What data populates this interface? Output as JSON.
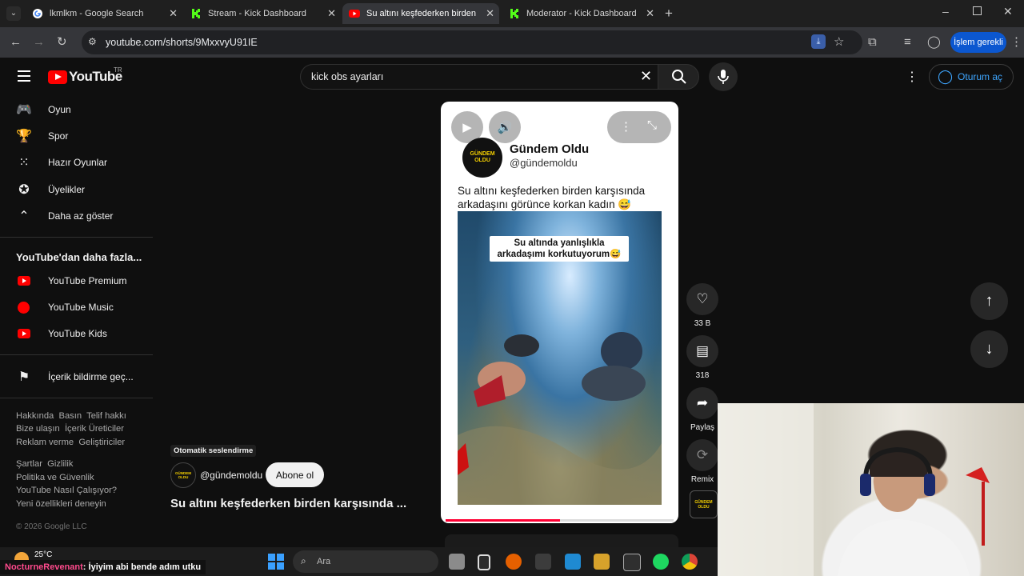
{
  "browser": {
    "tabs": [
      {
        "title": "lkmlkm - Google Search"
      },
      {
        "title": "Stream - Kick Dashboard"
      },
      {
        "title": "Su altını keşfederken birden karşı"
      },
      {
        "title": "Moderator - Kick Dashboard"
      }
    ],
    "url": "youtube.com/shorts/9MxxvyU91IE",
    "action_button": "İşlem gerekli"
  },
  "masthead": {
    "logo_text": "YouTube",
    "region": "TR",
    "search_value": "kick obs ayarları",
    "sign_in": "Oturum aç"
  },
  "sidebar": {
    "items": [
      {
        "label": "Oyun",
        "icon": "game-icon"
      },
      {
        "label": "Spor",
        "icon": "trophy-icon"
      },
      {
        "label": "Hazır Oyunlar",
        "icon": "grid-icon"
      },
      {
        "label": "Üyelikler",
        "icon": "membership-icon"
      },
      {
        "label": "Daha az göster",
        "icon": "chevron-up-icon"
      }
    ],
    "more_heading": "YouTube'dan daha fazla...",
    "more_items": [
      {
        "label": "YouTube Premium"
      },
      {
        "label": "YouTube Music"
      },
      {
        "label": "YouTube Kids"
      }
    ],
    "report": "İçerik bildirme geç...",
    "footer": {
      "row1": [
        "Hakkında",
        "Basın",
        "Telif hakkı"
      ],
      "row2": [
        "Bize ulaşın",
        "İçerik Üreticiler"
      ],
      "row3": [
        "Reklam verme",
        "Geliştiriciler"
      ],
      "row4": [
        "Şartlar",
        "Gizlilik"
      ],
      "row5": "Politika ve Güvenlik",
      "row6": "YouTube Nasıl Çalışıyor?",
      "row7": "Yeni özellikleri deneyin",
      "copyright": "© 2026 Google LLC"
    }
  },
  "short": {
    "account_name": "Gündem Oldu",
    "account_handle": "@gündemoldu",
    "avatar_text": "GÜNDEM OLDU",
    "caption": "Su altını keşfederken birden karşısında arkadaşını görünce korkan kadın 😅",
    "overlay_text": "Su altında yanlışlıkla arkadaşımı korkutuyorum😅",
    "progress": 0.5,
    "badge": "Otomatik seslendirme",
    "channel": "@gündemoldu",
    "subscribe": "Abone ol",
    "title": "Su altını keşfederken birden karşısında ..."
  },
  "actions": {
    "likes": "33 B",
    "comments": "318",
    "share": "Paylaş",
    "remix": "Remix"
  },
  "taskbar": {
    "weather_temp": "25°C",
    "search_placeholder": "Ara",
    "chat_user": "NocturneRevenant",
    "chat_message": ": İyiyim abi bende adım utku"
  }
}
